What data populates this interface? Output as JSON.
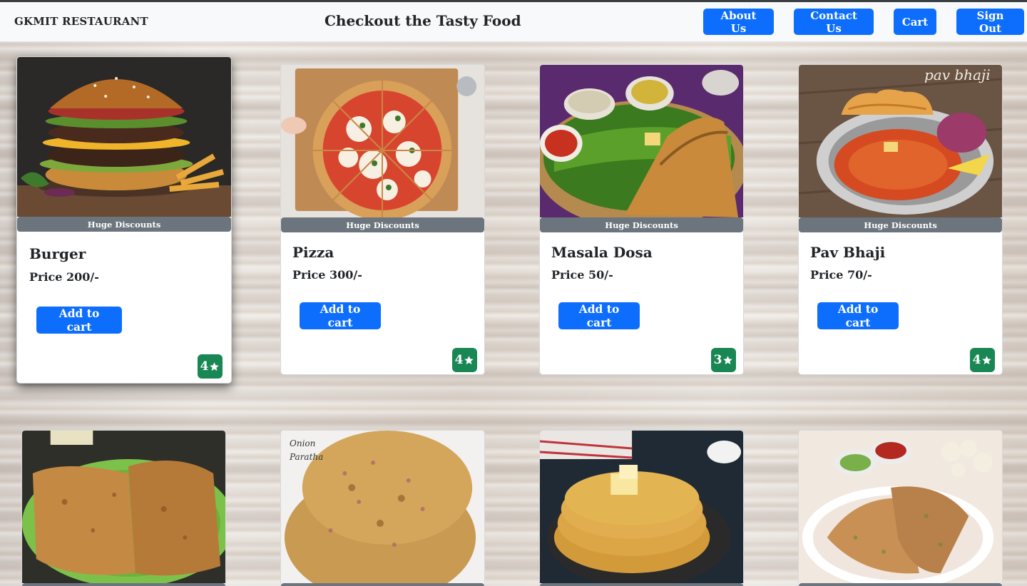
{
  "navbar": {
    "brand": "GKMIT RESTAURANT",
    "title": "Checkout the Tasty Food",
    "buttons": [
      "About Us",
      "Contact Us",
      "Cart",
      "Sign Out"
    ]
  },
  "colors": {
    "primary": "#0d6efd",
    "badge": "#6c757d",
    "rating": "#198754"
  },
  "cards": [
    {
      "name": "Burger",
      "price": "Price 200/-",
      "badge": "Huge Discounts",
      "button": "Add to cart",
      "rating": "4",
      "image": "burger-image"
    },
    {
      "name": "Pizza",
      "price": "Price 300/-",
      "badge": "Huge Discounts",
      "button": "Add to cart",
      "rating": "4",
      "image": "pizza-image"
    },
    {
      "name": "Masala Dosa",
      "price": "Price 50/-",
      "badge": "Huge Discounts",
      "button": "Add to cart",
      "rating": "3",
      "image": "masala-dosa-image"
    },
    {
      "name": "Pav Bhaji",
      "price": "Price 70/-",
      "badge": "Huge Discounts",
      "button": "Add to cart",
      "rating": "4",
      "image": "pav-bhaji-image"
    },
    {
      "image": "paratha-image"
    },
    {
      "image": "onion-paratha-image",
      "image_caption": [
        "Onion",
        "Paratha"
      ]
    },
    {
      "image": "butter-paratha-image"
    },
    {
      "image": "gobi-paratha-image"
    }
  ],
  "overlay_text": {
    "pav_bhaji_caption": "pav bhaji"
  }
}
